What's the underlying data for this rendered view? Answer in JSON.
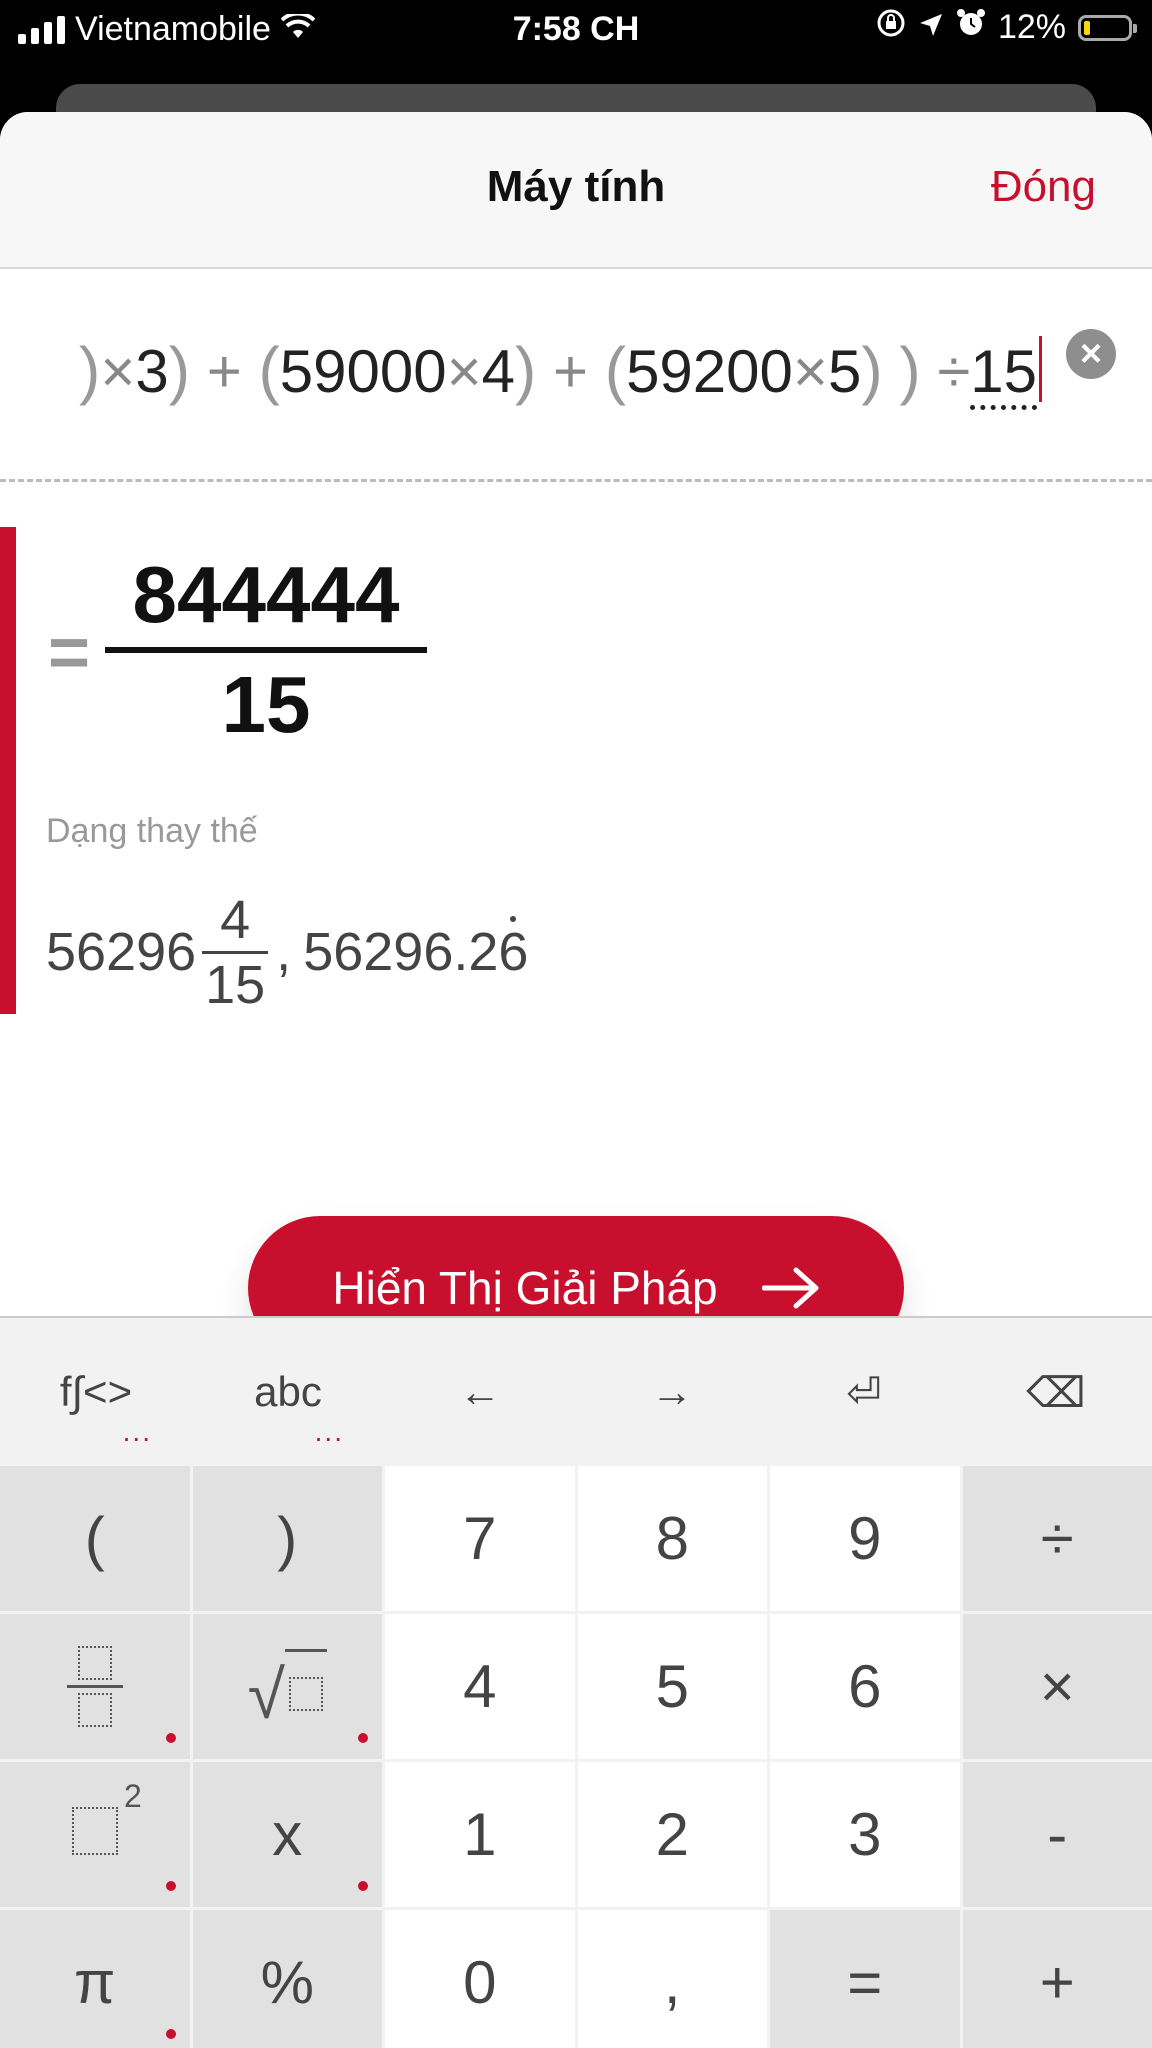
{
  "status_bar": {
    "carrier": "Vietnamobile",
    "time": "7:58 CH",
    "battery_percent": "12%",
    "battery_level": 0.12,
    "icons": [
      "signal-icon",
      "wifi-icon",
      "orientation-lock-icon",
      "location-icon",
      "alarm-icon",
      "battery-icon"
    ]
  },
  "header": {
    "title": "Máy tính",
    "close_label": "Đóng"
  },
  "expression": {
    "t1": ")",
    "t2": "×",
    "t3": "3",
    "t4": ")",
    "t5": "+",
    "t6": "(",
    "t7": "59000",
    "t8": "×",
    "t9": "4",
    "t10": ")",
    "t11": "+",
    "t12": "(",
    "t13": "59200",
    "t14": "×",
    "t15": "5",
    "t16": ")",
    "t17": ")",
    "t18": "÷",
    "t19": "15",
    "clear_icon": "×"
  },
  "result": {
    "equals": "=",
    "numerator": "844444",
    "denominator": "15",
    "alternate_label": "Dạng thay thế",
    "mixed_whole": "56296",
    "mixed_num": "4",
    "mixed_den": "15",
    "separator": ",",
    "decimal_prefix": "56296.2",
    "decimal_repeating": "6"
  },
  "solution_button": {
    "label": "Hiển Thị Giải Pháp"
  },
  "keyboard": {
    "function_row": [
      {
        "label": "f∫<>",
        "dots": "..."
      },
      {
        "label": "abc",
        "dots": "..."
      },
      {
        "label": "←"
      },
      {
        "label": "→"
      },
      {
        "label": "⏎"
      },
      {
        "label": "⌫"
      }
    ],
    "keys": {
      "open_paren": "(",
      "close_paren": ")",
      "seven": "7",
      "eight": "8",
      "nine": "9",
      "divide": "÷",
      "sqrt": "√",
      "four": "4",
      "five": "5",
      "six": "6",
      "multiply": "×",
      "square_exp": "2",
      "x": "x",
      "one": "1",
      "two": "2",
      "three": "3",
      "minus": "-",
      "pi": "π",
      "percent": "%",
      "zero": "0",
      "comma": ",",
      "equals": "=",
      "plus": "+"
    }
  },
  "colors": {
    "accent": "#c8102e",
    "key_gray": "#e1e1e1",
    "key_white": "#ffffff"
  }
}
